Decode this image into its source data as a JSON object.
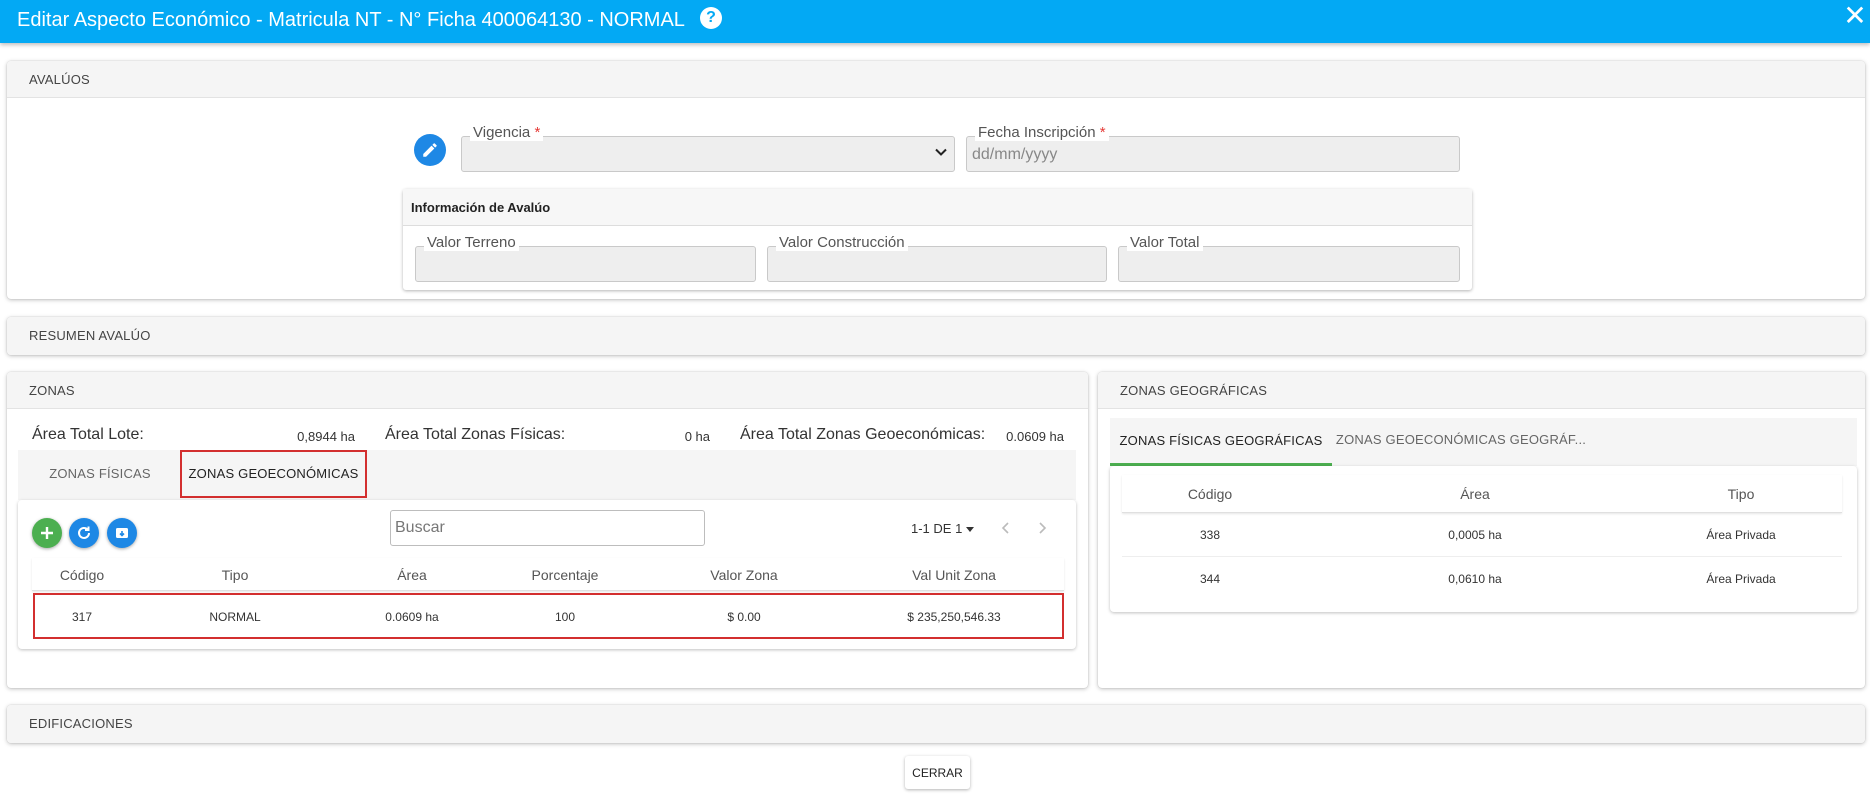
{
  "header": {
    "title": "Editar Aspecto Económico - Matricula NT - N° Ficha 400064130 - NORMAL",
    "help_glyph": "?",
    "close_glyph": "✕"
  },
  "avaluos": {
    "section_title": "AVALÚOS",
    "vigencia": {
      "label": "Vigencia",
      "required_mark": "*",
      "value": ""
    },
    "fecha_inscripcion": {
      "label": "Fecha Inscripción",
      "required_mark": "*",
      "placeholder": "dd/mm/yyyy"
    },
    "info": {
      "title": "Información de Avalúo",
      "valor_terreno_label": "Valor Terreno",
      "valor_construccion_label": "Valor Construcción",
      "valor_total_label": "Valor Total"
    }
  },
  "resumen": {
    "section_title": "RESUMEN AVALÚO"
  },
  "zonas": {
    "section_title": "ZONAS",
    "area_total_lote_label": "Área Total Lote:",
    "area_total_lote_value": "0,8944 ha",
    "area_zonas_fisicas_label": "Área Total Zonas Físicas:",
    "area_zonas_fisicas_value": "0 ha",
    "area_zonas_geo_label": "Área Total Zonas Geoeconómicas:",
    "area_zonas_geo_value": "0.0609 ha",
    "tabs": [
      "ZONAS FÍSICAS",
      "ZONAS GEOECONÓMICAS"
    ],
    "search_placeholder": "Buscar",
    "pager": "1-1 DE 1",
    "columns": [
      "Código",
      "Tipo",
      "Área",
      "Porcentaje",
      "Valor Zona",
      "Val Unit Zona"
    ],
    "rows": [
      [
        "317",
        "NORMAL",
        "0.0609 ha",
        "100",
        "$ 0.00",
        "$ 235,250,546.33"
      ]
    ]
  },
  "geo": {
    "section_title": "ZONAS GEOGRÁFICAS",
    "tabs": [
      "ZONAS FÍSICAS GEOGRÁFICAS",
      "ZONAS GEOECONÓMICAS GEOGRÁF..."
    ],
    "columns": [
      "Código",
      "Área",
      "Tipo"
    ],
    "rows": [
      [
        "338",
        "0,0005 ha",
        "Área Privada"
      ],
      [
        "344",
        "0,0610 ha",
        "Área Privada"
      ]
    ]
  },
  "edificaciones": {
    "section_title": "EDIFICACIONES"
  },
  "footer": {
    "close_label": "CERRAR"
  },
  "colors": {
    "primary": "#03a9f4",
    "highlight": "#d32f2f",
    "add": "#4caf50",
    "refresh": "#1e88e5",
    "active_tab": "#4caf50"
  },
  "icons": [
    "help-icon",
    "close-icon",
    "edit-icon",
    "chevron-down-icon",
    "add-icon",
    "refresh-icon",
    "archive-icon",
    "chevron-left-icon",
    "chevron-right-icon"
  ]
}
